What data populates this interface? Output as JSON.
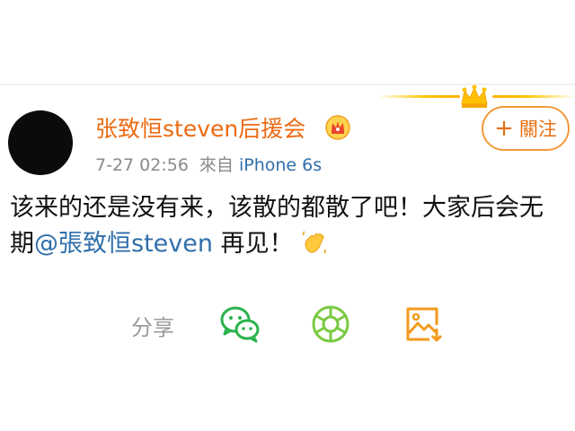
{
  "post": {
    "username": "张致恒steven后援会",
    "time": "7-27 02:56",
    "source_prefix": "來自",
    "source": "iPhone 6s",
    "follow_label": "關注",
    "text_part1": "该来的还是没有来，该散的都散了吧！大家后会无期",
    "mention": "@張致恒steven",
    "text_part2": " 再见！"
  },
  "share": {
    "label": "分享",
    "targets": [
      "wechat-icon",
      "moments-icon",
      "save-image-icon"
    ]
  },
  "colors": {
    "username": "#eb6a12",
    "link": "#2f6fab",
    "follow_border": "#f09a3c",
    "icon_green": "#2bb24c",
    "icon_lime": "#7ac943",
    "icon_orange": "#f39a1e"
  }
}
